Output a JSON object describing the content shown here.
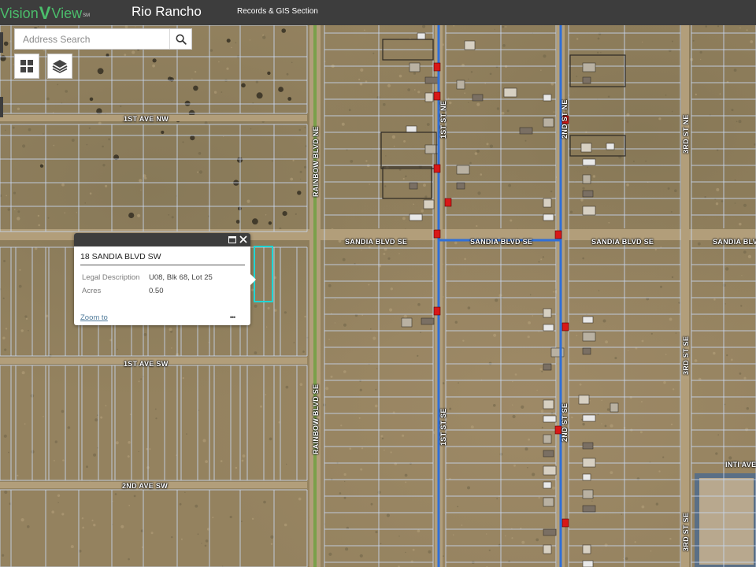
{
  "header": {
    "logo_vision": "Vision",
    "logo_view": "View",
    "logo_sm": "SM",
    "city": "Rio Rancho",
    "section": "Records & GIS Section"
  },
  "search": {
    "placeholder": "Address Search"
  },
  "tools": {
    "basemap_icon": "grid-icon",
    "layers_icon": "layers-icon"
  },
  "map": {
    "roads": {
      "first_ave_nw": "1ST AVE NW",
      "first_ave_sw": "1ST AVE SW",
      "second_ave_sw": "2ND AVE SW",
      "rainbow_ne": "RAINBOW BLVD NE",
      "rainbow_se": "RAINBOW BLVD SE",
      "sandia_1": "SANDIA BLVD SE",
      "sandia_2": "SANDIA BLVD SE",
      "sandia_3": "SANDIA BLVD SE",
      "sandia_4": "SANDIA BLVD SE",
      "first_st_ne": "1ST ST NE",
      "first_st_se": "1ST ST SE",
      "second_st_ne": "2ND ST NE",
      "second_st_se": "2ND ST SE",
      "third_st_ne": "3RD ST NE",
      "third_st_se_1": "3RD ST SE",
      "third_st_se_2": "3RD ST SE",
      "inti_ave": "INTI AVE"
    },
    "colors": {
      "parcel_line": "#c8d6ee",
      "selected_parcel": "#1fd6d6",
      "water_line": "#2f6fd8",
      "hydrant": "#d81818",
      "rainbow_median": "#7aa04a"
    }
  },
  "popup": {
    "title": "18 SANDIA BLVD SW",
    "fields": [
      {
        "name": "Legal Description",
        "value": "U08, Blk 68, Lot 25"
      },
      {
        "name": "Acres",
        "value": "0.50"
      }
    ],
    "zoom_to": "Zoom to",
    "more": "•••"
  }
}
